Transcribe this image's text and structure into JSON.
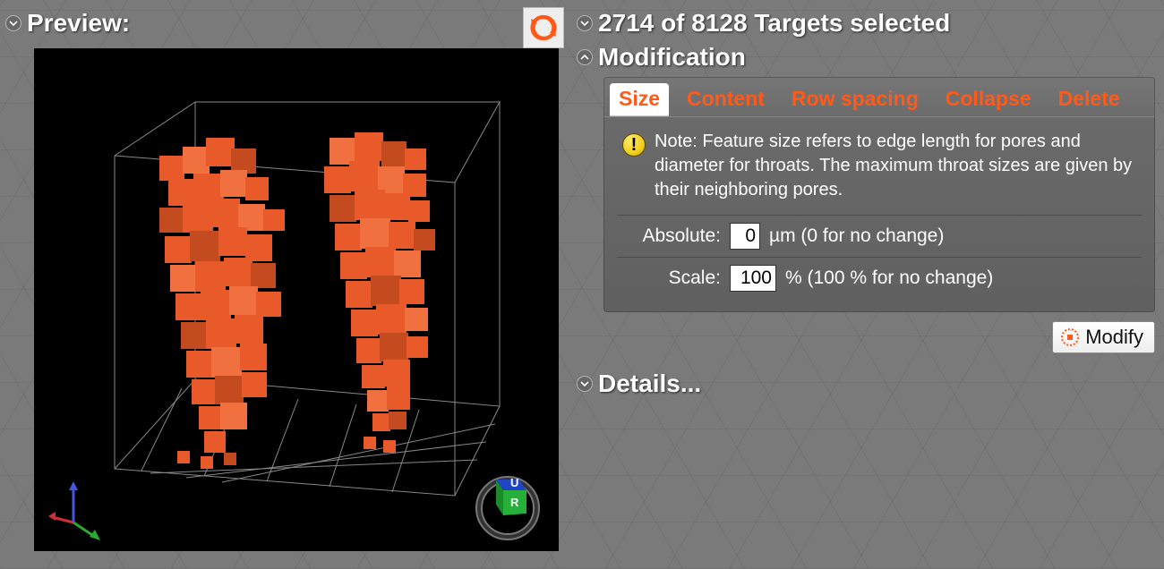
{
  "preview": {
    "title": "Preview:"
  },
  "targets": {
    "selected": 2714,
    "total": 8128,
    "label": "2714 of 8128 Targets selected"
  },
  "modification": {
    "title": "Modification",
    "tabs": {
      "size": "Size",
      "content": "Content",
      "row_spacing": "Row spacing",
      "collapse": "Collapse",
      "delete": "Delete"
    },
    "note": "Note: Feature size refers to edge length for pores and diameter for throats. The maximum throat sizes are given by their neighboring pores.",
    "absolute": {
      "label": "Absolute:",
      "value": "0",
      "unit_hint": "µm (0 for no change)"
    },
    "scale": {
      "label": "Scale:",
      "value": "100",
      "unit_hint": "% (100 % for no change)"
    },
    "modify_label": "Modify"
  },
  "details": {
    "title": "Details..."
  },
  "viewcube": {
    "top": "U",
    "front": "R"
  },
  "colors": {
    "accent": "#ff5a1a",
    "voxel": "#e85a2a"
  }
}
